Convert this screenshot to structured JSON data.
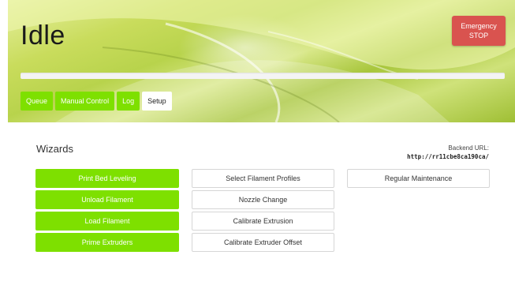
{
  "status": {
    "title": "Idle"
  },
  "emergency": {
    "line1": "Emergency",
    "line2": "STOP"
  },
  "progress": {
    "fraction": 0.0
  },
  "tabs": [
    {
      "label": "Queue",
      "active": false
    },
    {
      "label": "Manual Control",
      "active": false
    },
    {
      "label": "Log",
      "active": false
    },
    {
      "label": "Setup",
      "active": true
    }
  ],
  "wizards": {
    "title": "Wizards",
    "backend_label": "Backend URL:",
    "backend_url": "http://rr11cbe8ca190ca/",
    "col1": [
      "Print Bed Leveling",
      "Unload Filament",
      "Load Filament",
      "Prime Extruders"
    ],
    "col2": [
      "Select Filament Profiles",
      "Nozzle Change",
      "Calibrate Extrusion",
      "Calibrate Extruder Offset"
    ],
    "col3": [
      "Regular Maintenance"
    ]
  },
  "colors": {
    "accent": "#7ee000",
    "danger": "#d9534f"
  }
}
